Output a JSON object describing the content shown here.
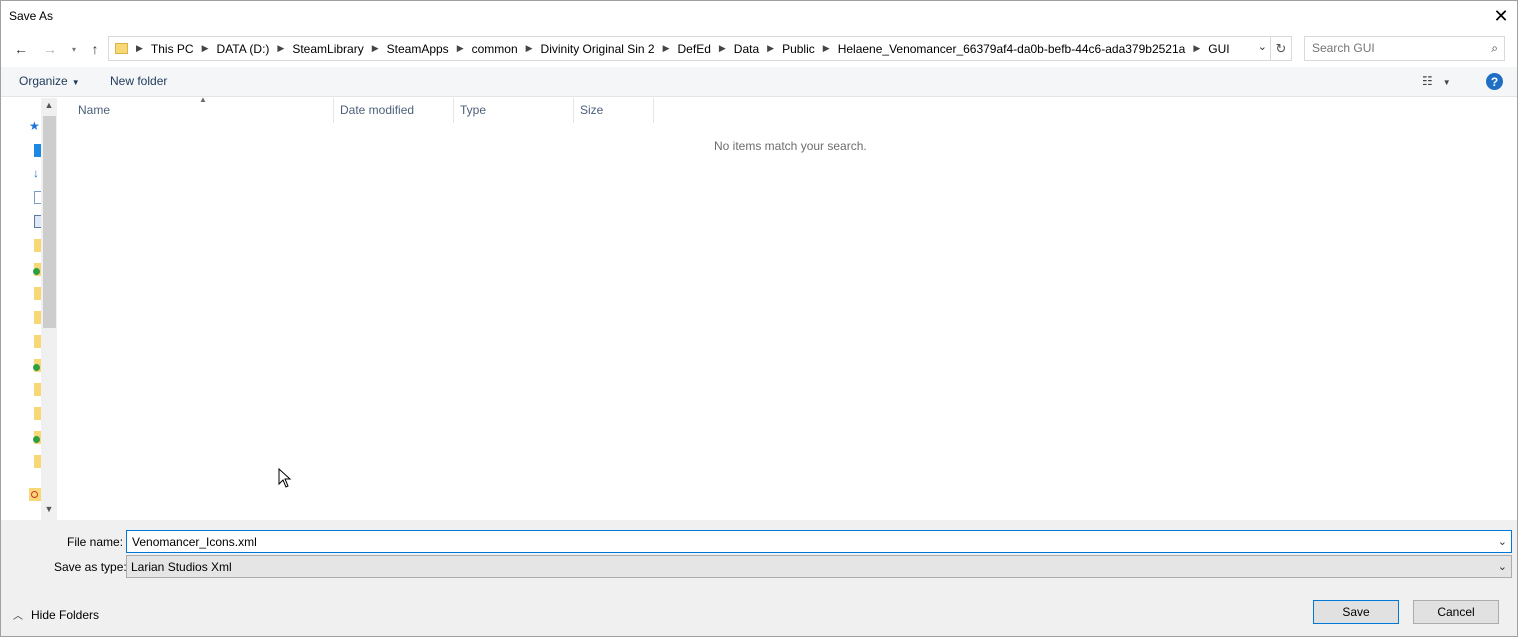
{
  "window": {
    "title": "Save As"
  },
  "address": {
    "crumbs": [
      "This PC",
      "DATA (D:)",
      "SteamLibrary",
      "SteamApps",
      "common",
      "Divinity Original Sin 2",
      "DefEd",
      "Data",
      "Public",
      "Helaene_Venomancer_66379af4-da0b-befb-44c6-ada379b2521a",
      "GUI"
    ]
  },
  "search": {
    "placeholder": "Search GUI"
  },
  "toolbar": {
    "organize_label": "Organize",
    "new_folder_label": "New folder",
    "help_label": "?"
  },
  "columns": {
    "name": "Name",
    "date": "Date modified",
    "type": "Type",
    "size": "Size"
  },
  "filelist": {
    "empty_message": "No items match your search."
  },
  "form": {
    "file_name_label": "File name:",
    "file_name_value": "Venomancer_Icons.xml",
    "type_label": "Save as type:",
    "type_value": "Larian Studios Xml"
  },
  "footer": {
    "hide_folders_label": "Hide Folders",
    "save_label": "Save",
    "cancel_label": "Cancel"
  }
}
